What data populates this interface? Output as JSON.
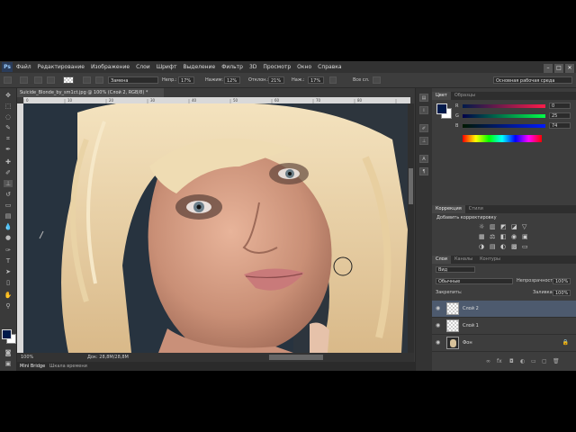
{
  "menu": {
    "logo": "Ps",
    "items": [
      "Файл",
      "Редактирование",
      "Изображение",
      "Слои",
      "Шрифт",
      "Выделение",
      "Фильтр",
      "3D",
      "Просмотр",
      "Окно",
      "Справка"
    ]
  },
  "window_buttons": [
    "–",
    "□",
    "✕"
  ],
  "options": {
    "mode_value": "Замена",
    "opacity_label": "Непр.:",
    "opacity_value": "17%",
    "flow_label": "Нажим:",
    "flow_value": "12%",
    "strength_label": "Отклон.:",
    "strength_value": "21%",
    "fill_label": "Наж.:",
    "fill_value": "17%",
    "all_layers": "Все сл.",
    "workspace": "Основная рабочая среда"
  },
  "document": {
    "tab_title": "Suicide_Blonde_by_sm1ct.jpg @ 100% (Слой 2, RGB/8) *",
    "ruler_ticks": [
      "0",
      "10",
      "20",
      "30",
      "40",
      "50",
      "60",
      "70",
      "80"
    ],
    "zoom": "100%",
    "doc_size": "Док: 28,8M/28,8M"
  },
  "bottom_tabs": {
    "mini_bridge": "Mini Bridge",
    "timeline": "Шкала времени"
  },
  "color_panel": {
    "tabs": [
      "Цвет",
      "Образцы"
    ],
    "r_label": "R",
    "g_label": "G",
    "b_label": "B",
    "r_value": "0",
    "g_value": "25",
    "b_value": "74",
    "foreground_color": "#00194a"
  },
  "adjustments_panel": {
    "tabs": [
      "Коррекция",
      "Стили"
    ],
    "title": "Добавить корректировку"
  },
  "layers_panel": {
    "tabs": [
      "Слои",
      "Каналы",
      "Контуры"
    ],
    "kind": "Вид",
    "blend_mode": "Обычные",
    "opacity_label": "Непрозрачность:",
    "opacity_value": "100%",
    "lock_label": "Закрепить:",
    "fill_label": "Заливка:",
    "fill_value": "100%",
    "layers": [
      {
        "name": "Слой 2",
        "selected": true
      },
      {
        "name": "Слой 1",
        "selected": false
      },
      {
        "name": "Фон",
        "selected": false
      }
    ]
  },
  "icons": [
    "ps-logo",
    "brush-icon",
    "eye-icon",
    "lock-icon",
    "move-icon",
    "lasso-icon",
    "crop-icon",
    "eyedropper-icon",
    "healing-icon",
    "eraser-icon",
    "gradient-icon",
    "dodge-icon",
    "pen-icon",
    "text-icon",
    "hand-icon",
    "zoom-icon"
  ]
}
